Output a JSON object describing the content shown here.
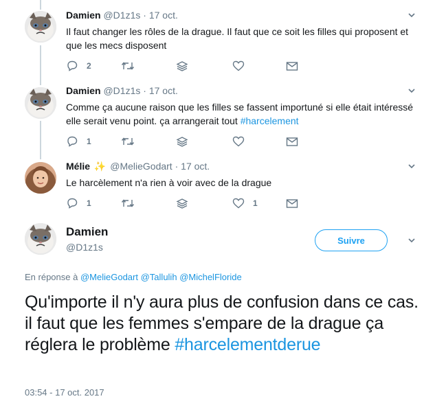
{
  "tweets": [
    {
      "name": "Damien",
      "handle": "@D1z1s",
      "separator": "·",
      "date": "17 oct.",
      "text": "Il faut changer les rôles de la drague. Il faut que ce soit les filles qui proposent et que les mecs disposent",
      "hashtag": "",
      "replies": "2",
      "retweets": "",
      "likes": ""
    },
    {
      "name": "Damien",
      "handle": "@D1z1s",
      "separator": "·",
      "date": "17 oct.",
      "text": "Comme ça aucune raison que les filles se fassent importuné si elle était intéressé elle serait venu point. ça arrangerait tout ",
      "hashtag": "#harcelement",
      "replies": "1",
      "retweets": "",
      "likes": ""
    },
    {
      "name": "Mélie",
      "badge": "✨",
      "handle": "@MelieGodart",
      "separator": "·",
      "date": "17 oct.",
      "text": "Le harcèlement n'a rien à voir avec de la drague",
      "hashtag": "",
      "replies": "1",
      "retweets": "",
      "likes": "1"
    }
  ],
  "main_tweet": {
    "name": "Damien",
    "handle": "@D1z1s",
    "follow_label": "Suivre",
    "reply_prefix": "En réponse à",
    "mentions": [
      "@MelieGodart",
      "@Tallulih",
      "@MichelFloride"
    ],
    "text": "Qu'importe il n'y aura plus de confusion dans ce cas. il faut que les femmes s'empare de la drague ça réglera le problème ",
    "hashtag": "#harcelementderue",
    "timestamp": "03:54 - 17 oct. 2017"
  },
  "colors": {
    "accent": "#1da1f2",
    "link": "#1b95e0",
    "secondary_text": "#657786",
    "thread_line": "#ccd6dd"
  },
  "icons": {
    "reply": "reply-icon",
    "retweet": "retweet-icon",
    "dm": "stack-icon",
    "like": "heart-icon",
    "share": "envelope-icon",
    "more": "chevron-down-icon",
    "badge": "sparkles-icon"
  }
}
